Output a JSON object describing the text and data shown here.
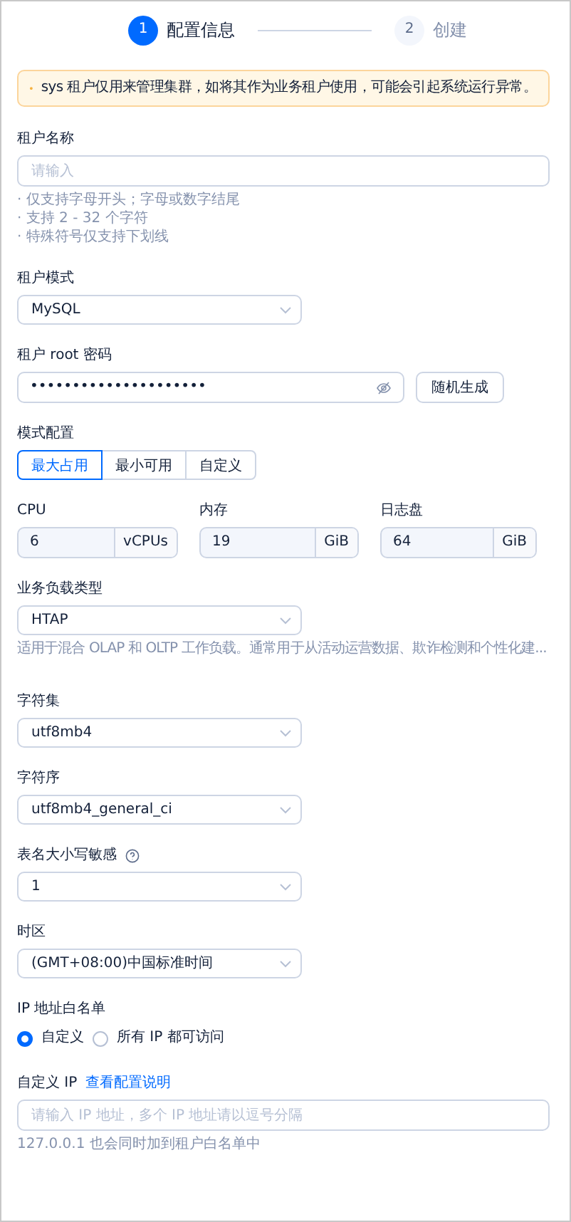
{
  "steps": [
    {
      "number": "1",
      "label": "配置信息",
      "selected": true
    },
    {
      "number": "2",
      "label": "创建",
      "selected": false
    }
  ],
  "alert": {
    "text": "sys 租户仅用来管理集群，如将其作为业务租户使用，可能会引起系统运行异常。"
  },
  "fields": [
    {
      "kind": "text",
      "label": "租户名称",
      "placeholder": "请输入",
      "hints": [
        "· 仅支持字母开头；字母或数字结尾",
        "· 支持 2 - 32 个字符",
        "· 特殊符号仅支持下划线"
      ]
    },
    {
      "kind": "select",
      "label": "租户模式",
      "value": "MySQL"
    },
    {
      "kind": "password",
      "label": "租户 root 密码",
      "value": "•••••••••••••••••••••",
      "button": "随机生成"
    },
    {
      "kind": "segmented",
      "label": "模式配置",
      "options": [
        {
          "label": "最大占用",
          "selected": true
        },
        {
          "label": "最小可用",
          "selected": false
        },
        {
          "label": "自定义",
          "selected": false
        }
      ]
    },
    {
      "kind": "resources",
      "items": [
        {
          "label": "CPU",
          "value": "6",
          "unit": "vCPUs"
        },
        {
          "label": "内存",
          "value": "19",
          "unit": "GiB"
        },
        {
          "label": "日志盘",
          "value": "64",
          "unit": "GiB"
        }
      ]
    },
    {
      "kind": "select",
      "label": "业务负载类型",
      "value": "HTAP",
      "description": "适用于混合 OLAP 和 OLTP 工作负载。通常用于从活动运营数据、欺诈检测和个性化建..."
    },
    {
      "kind": "select",
      "label": "字符集",
      "value": "utf8mb4"
    },
    {
      "kind": "select",
      "label": "字符序",
      "value": "utf8mb4_general_ci"
    },
    {
      "kind": "select",
      "label": "表名大小写敏感",
      "help": true,
      "value": "1"
    },
    {
      "kind": "select",
      "label": "时区",
      "value": "(GMT+08:00)中国标准时间"
    },
    {
      "kind": "radio",
      "label": "IP 地址白名单",
      "options": [
        {
          "label": "自定义",
          "selected": true
        },
        {
          "label": "所有 IP 都可访问",
          "selected": false
        }
      ]
    },
    {
      "kind": "text",
      "label": "自定义 IP",
      "link": "查看配置说明",
      "placeholder": "请输入 IP 地址，多个 IP 地址请以逗号分隔",
      "hints": [
        "127.0.0.1 也会同时加到租户白名单中"
      ]
    }
  ]
}
